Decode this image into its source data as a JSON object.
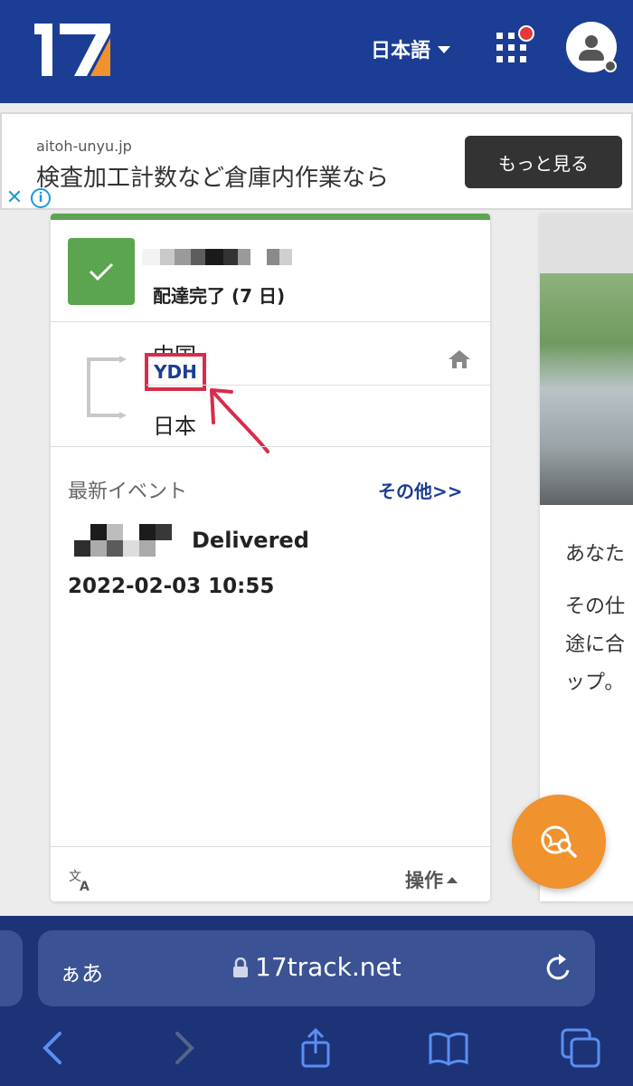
{
  "header": {
    "logo_text": "17",
    "language_label": "日本語"
  },
  "ad": {
    "domain": "aitoh-unyu.jp",
    "headline": "検査加工計数など倉庫内作業なら",
    "cta": "もっと見る",
    "close_glyph": "✕",
    "info_glyph": "i"
  },
  "tracking_card": {
    "status": "配達完了 (7 日)",
    "origin": "中国",
    "carrier": "YDH",
    "destination": "日本",
    "latest_events_title": "最新イベント",
    "more_link": "その他>>",
    "event_status": "Delivered",
    "event_time": "2022-02-03 10:55",
    "operations_label": "操作",
    "status_color": "#5ba550"
  },
  "side_card": {
    "lines": [
      "あなた",
      "その仕",
      "途に合",
      "ップ。"
    ]
  },
  "browser": {
    "text_size_label": "ぁあ",
    "url": "17track.net"
  },
  "colors": {
    "header": "#1b3d93",
    "accent_orange": "#f0922e",
    "highlight_red": "#d92c4a"
  }
}
